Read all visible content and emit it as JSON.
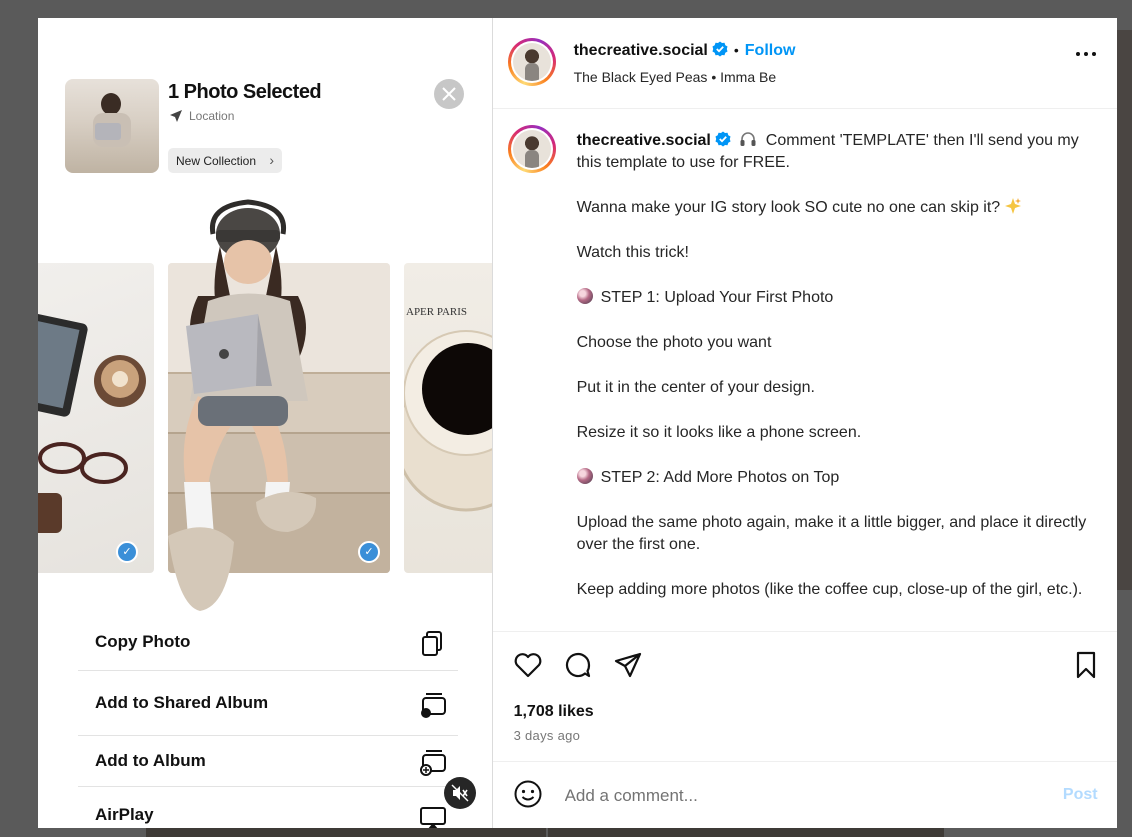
{
  "post_media": {
    "selection_title": "1 Photo Selected",
    "location_label": "Location",
    "new_collection_label": "New Collection",
    "menu": [
      {
        "label": "Copy Photo",
        "icon": "copy-icon"
      },
      {
        "label": "Add to Shared Album",
        "icon": "shared-album-icon"
      },
      {
        "label": "Add to Album",
        "icon": "add-album-icon"
      },
      {
        "label": "AirPlay",
        "icon": "airplay-icon"
      }
    ],
    "mute_icon": "speaker-muted-icon"
  },
  "header": {
    "username": "thecreative.social",
    "separator": "•",
    "follow_label": "Follow",
    "audio_text": "The Black Eyed Peas • Imma Be"
  },
  "caption": {
    "username": "thecreative.social",
    "first_line": "Comment 'TEMPLATE' then I'll send you my this template to use for FREE.",
    "paragraphs": [
      "Wanna make your IG story look SO cute no one can skip it?",
      "Watch this trick!",
      "STEP 1: Upload Your First Photo",
      "Choose the photo you want",
      "Put it in the center of your design.",
      "Resize it so it looks like a phone screen.",
      "STEP 2: Add More Photos on Top",
      "Upload the same photo again, make it a little bigger, and place it directly over the first one.",
      "Keep adding more photos (like the coffee cup, close-up of the girl, etc.)."
    ]
  },
  "engagement": {
    "likes": "1,708 likes",
    "time_ago": "3 days ago"
  },
  "comment_box": {
    "placeholder": "Add a comment...",
    "post_label": "Post"
  },
  "colors": {
    "accent": "#0095f6",
    "post_disabled": "#b3dbff",
    "verified": "#0095f6",
    "check_blue": "#3a8fd8"
  }
}
